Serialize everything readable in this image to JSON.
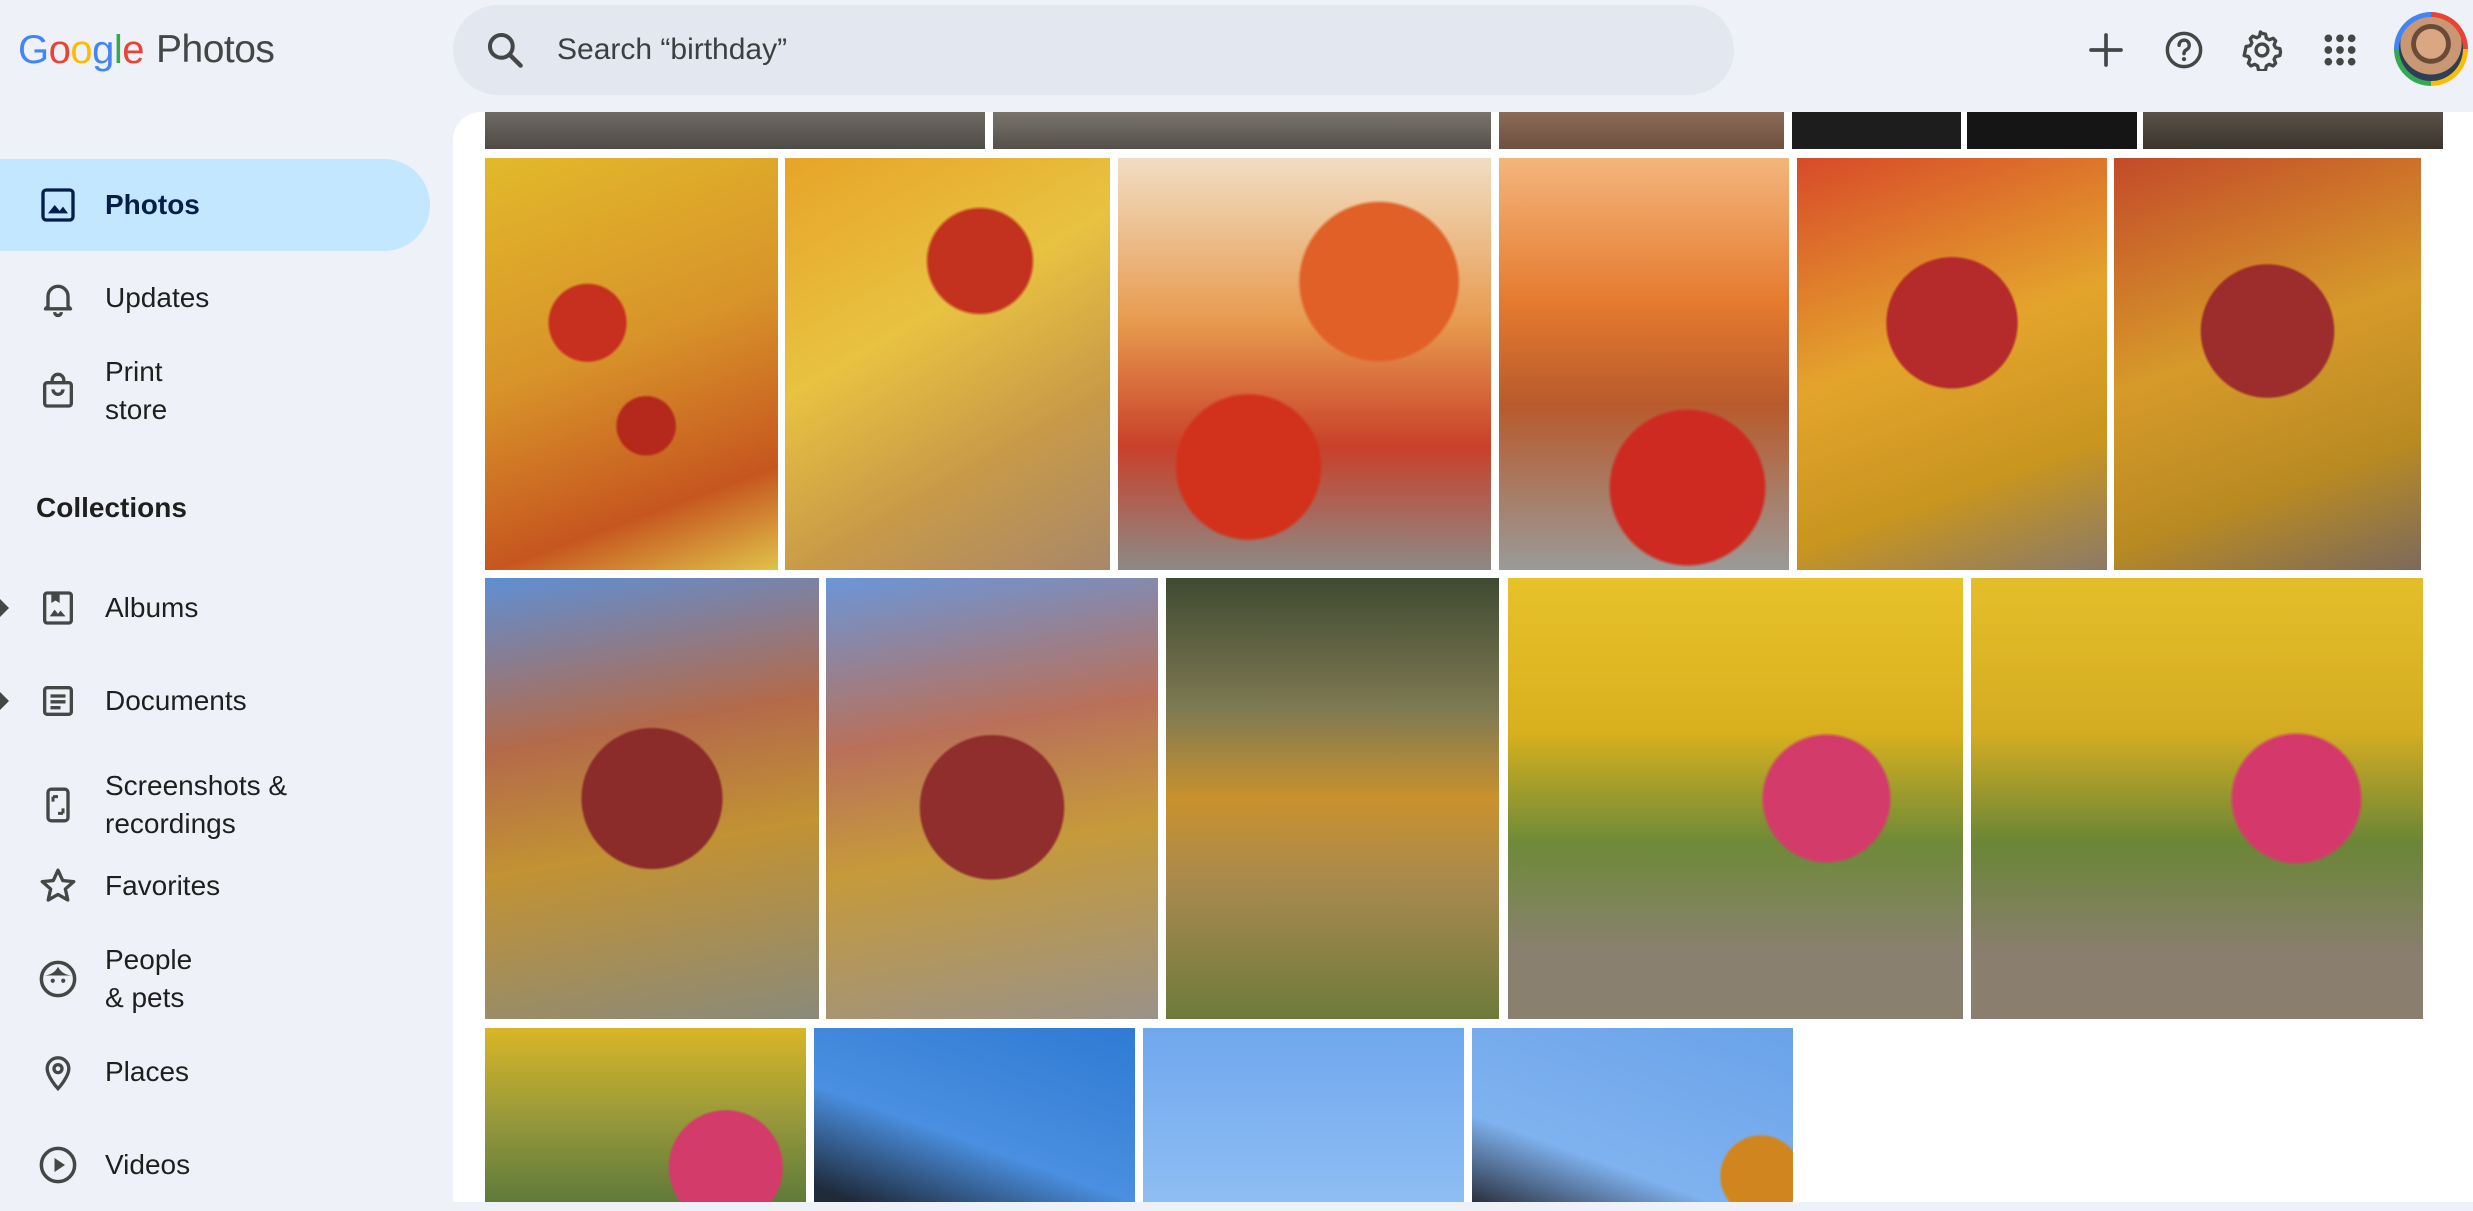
{
  "header": {
    "logo": {
      "letters": [
        "G",
        "o",
        "o",
        "g",
        "l",
        "e"
      ],
      "product": "Photos"
    },
    "search": {
      "placeholder": "Search “birthday”"
    },
    "icons": [
      "add-icon",
      "help-icon",
      "settings-icon",
      "apps-icon"
    ]
  },
  "sidebar": {
    "items": [
      {
        "label": "Photos",
        "icon": "photo-icon",
        "active": true
      },
      {
        "label": "Updates",
        "icon": "bell-icon"
      },
      {
        "label": "Print store",
        "icon": "shopping-bag-icon"
      }
    ],
    "collections_title": "Collections",
    "collections": [
      {
        "label": "Albums",
        "icon": "album-icon",
        "expandable": true
      },
      {
        "label": "Documents",
        "icon": "document-icon",
        "expandable": true
      },
      {
        "label": "Screenshots & recordings",
        "icon": "phone-screenshot-icon"
      },
      {
        "label": "Favorites",
        "icon": "star-icon"
      },
      {
        "label": "People & pets",
        "icon": "face-icon"
      },
      {
        "label": "Places",
        "icon": "location-pin-icon"
      },
      {
        "label": "Videos",
        "icon": "play-circle-icon"
      }
    ]
  },
  "colors": {
    "accent_active": "#c2e7ff",
    "background": "#eef2f8",
    "google_blue": "#4285f4",
    "google_red": "#ea4335",
    "google_yellow": "#fbbc05",
    "google_green": "#34a853"
  }
}
